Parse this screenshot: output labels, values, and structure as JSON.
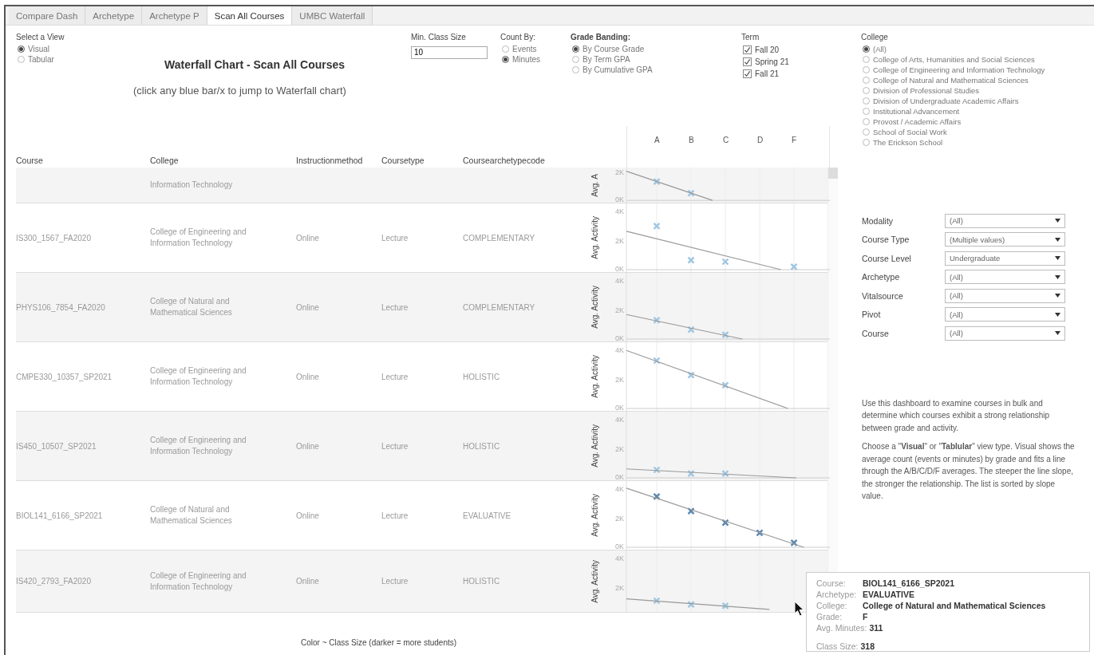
{
  "tabs": [
    {
      "label": "Compare Dash",
      "selected": false
    },
    {
      "label": "Archetype",
      "selected": false
    },
    {
      "label": "Archetype P",
      "selected": false
    },
    {
      "label": "Scan All Courses",
      "selected": true
    },
    {
      "label": "UMBC Waterfall",
      "selected": false
    }
  ],
  "view_selector": {
    "label": "Select a View",
    "options": [
      {
        "label": "Visual",
        "selected": true
      },
      {
        "label": "Tabular",
        "selected": false
      }
    ]
  },
  "title": "Waterfall Chart - Scan All Courses",
  "subtitle": "(click any blue bar/x to jump to Waterfall chart)",
  "min_class_size": {
    "label": "Min. Class Size",
    "value": "10"
  },
  "count_by": {
    "label": "Count By:",
    "options": [
      {
        "label": "Events",
        "selected": false
      },
      {
        "label": "Minutes",
        "selected": true
      }
    ]
  },
  "grade_banding": {
    "label": "Grade Banding:",
    "options": [
      {
        "label": "By Course Grade",
        "selected": true
      },
      {
        "label": "By Term GPA",
        "selected": false
      },
      {
        "label": "By Cumulative GPA",
        "selected": false
      }
    ]
  },
  "term": {
    "label": "Term",
    "options": [
      {
        "label": "Fall 20",
        "checked": true
      },
      {
        "label": "Spring 21",
        "checked": true
      },
      {
        "label": "Fall 21",
        "checked": true
      }
    ]
  },
  "college": {
    "label": "College",
    "options": [
      {
        "label": "(All)",
        "selected": true
      },
      {
        "label": "College of Arts, Humanities and Social Sciences",
        "selected": false
      },
      {
        "label": "College of Engineering and Information Technology",
        "selected": false
      },
      {
        "label": "College of Natural and Mathematical Sciences",
        "selected": false
      },
      {
        "label": "Division of Professional Studies",
        "selected": false
      },
      {
        "label": "Division of Undergraduate Academic Affairs",
        "selected": false
      },
      {
        "label": "Institutional Advancement",
        "selected": false
      },
      {
        "label": "Provost / Academic Affairs",
        "selected": false
      },
      {
        "label": "School of Social Work",
        "selected": false
      },
      {
        "label": "The Erickson School",
        "selected": false
      }
    ]
  },
  "table": {
    "columns": [
      "Course",
      "College",
      "Instructionmethod",
      "Coursetype",
      "Coursearchetypecode"
    ],
    "grades": [
      "A",
      "B",
      "C",
      "D",
      "F"
    ],
    "rows": [
      {
        "college": "Information Technology",
        "axis_title": "Avg. A",
        "color": "#9fc6e2",
        "chart_data": {
          "type": "scatter",
          "ylim": [
            0,
            2100
          ],
          "yticks": [
            {
              "value": 2000,
              "label": "2K"
            },
            {
              "value": 0,
              "label": "0K"
            }
          ],
          "values": [
            1300,
            500,
            null,
            null,
            null
          ]
        }
      },
      {
        "course": "IS300_1567_FA2020",
        "college": "College of Engineering and Information Technology",
        "method": "Online",
        "type": "Lecture",
        "archetype": "COMPLEMENTARY",
        "axis_title": "Avg. Activity",
        "color": "#9fc6e2",
        "chart_data": {
          "type": "scatter",
          "ylim": [
            0,
            4400
          ],
          "yticks": [
            {
              "value": 4000,
              "label": "4K"
            },
            {
              "value": 2000,
              "label": "2K"
            },
            {
              "value": 0,
              "label": "0K"
            }
          ],
          "values": [
            3000,
            650,
            550,
            null,
            200
          ]
        }
      },
      {
        "course": "PHYS106_7854_FA2020",
        "college": "College of Natural and Mathematical Sciences",
        "method": "Online",
        "type": "Lecture",
        "archetype": "COMPLEMENTARY",
        "axis_title": "Avg. Activity",
        "color": "#9fc6e2",
        "chart_data": {
          "type": "scatter",
          "ylim": [
            0,
            4400
          ],
          "yticks": [
            {
              "value": 4000,
              "label": "4K"
            },
            {
              "value": 2000,
              "label": "2K"
            },
            {
              "value": 0,
              "label": "0K"
            }
          ],
          "values": [
            1300,
            650,
            300,
            null,
            null
          ]
        }
      },
      {
        "course": "CMPE330_10357_SP2021",
        "college": "College of Engineering and Information Technology",
        "method": "Online",
        "type": "Lecture",
        "archetype": "HOLISTIC",
        "axis_title": "Avg. Activity",
        "color": "#9fc6e2",
        "chart_data": {
          "type": "scatter",
          "ylim": [
            0,
            4400
          ],
          "yticks": [
            {
              "value": 4000,
              "label": "4K"
            },
            {
              "value": 2000,
              "label": "2K"
            },
            {
              "value": 0,
              "label": "0K"
            }
          ],
          "values": [
            3300,
            2300,
            1600,
            null,
            null
          ]
        }
      },
      {
        "course": "IS450_10507_SP2021",
        "college": "College of Engineering and Information Technology",
        "method": "Online",
        "type": "Lecture",
        "archetype": "HOLISTIC",
        "axis_title": "Avg. Activity",
        "color": "#9fc6e2",
        "chart_data": {
          "type": "scatter",
          "ylim": [
            0,
            4400
          ],
          "yticks": [
            {
              "value": 4000,
              "label": "4K"
            },
            {
              "value": 2000,
              "label": "2K"
            },
            {
              "value": 0,
              "label": "0K"
            }
          ],
          "values": [
            550,
            300,
            300,
            null,
            null
          ]
        }
      },
      {
        "course": "BIOL141_6166_SP2021",
        "college": "College of Natural and Mathematical Sciences",
        "method": "Online",
        "type": "Lecture",
        "archetype": "EVALUATIVE",
        "axis_title": "Avg. Activity",
        "color": "#5b88b0",
        "chart_data": {
          "type": "scatter",
          "ylim": [
            0,
            4400
          ],
          "yticks": [
            {
              "value": 4000,
              "label": "4K"
            },
            {
              "value": 2000,
              "label": "2K"
            },
            {
              "value": 0,
              "label": "0K"
            }
          ],
          "values": [
            3500,
            2500,
            1700,
            1000,
            311
          ]
        }
      },
      {
        "course": "IS420_2793_FA2020",
        "college": "College of Engineering and Information Technology",
        "method": "Online",
        "type": "Lecture",
        "archetype": "HOLISTIC",
        "axis_title": "Avg. Activity",
        "color": "#9fc6e2",
        "chart_data": {
          "type": "scatter",
          "ylim": [
            500,
            4400
          ],
          "yticks": [
            {
              "value": 4000,
              "label": "4K"
            },
            {
              "value": 2000,
              "label": "2K"
            }
          ],
          "values": [
            1100,
            850,
            750,
            null,
            null
          ]
        }
      }
    ]
  },
  "legend_note": "Color ~ Class Size (darker = more students)",
  "filters": [
    {
      "label": "Modality",
      "value": "(All)"
    },
    {
      "label": "Course Type",
      "value": "(Multiple values)"
    },
    {
      "label": "Course Level",
      "value": "Undergraduate"
    },
    {
      "label": "Archetype",
      "value": "(All)"
    },
    {
      "label": "Vitalsource",
      "value": "(All)"
    },
    {
      "label": "Pivot",
      "value": "(All)"
    },
    {
      "label": "Course",
      "value": "(All)"
    }
  ],
  "description": [
    "Use this dashboard to examine courses in bulk and determine which courses exhibit a strong relationship between grade and activity.",
    "Choose a \"**Visual**\" or \"**Tablular**\" view type. Visual shows the average count (events or minutes) by grade and fits a line through the A/B/C/D/F averages. The steeper the line slope, the stronger the relationship. The list is sorted by slope value."
  ],
  "tooltip": {
    "rows": [
      {
        "label": "Course:",
        "value": "BIOL141_6166_SP2021"
      },
      {
        "label": "Archetype:",
        "value": "EVALUATIVE"
      },
      {
        "label": "College:",
        "value": "College of Natural and Mathematical Sciences"
      },
      {
        "label": "Grade:",
        "value": "F"
      }
    ],
    "inline": {
      "label": "Avg. Minutes:",
      "value": "311"
    },
    "class_size": {
      "label": "Class Size:",
      "value": "318"
    }
  }
}
